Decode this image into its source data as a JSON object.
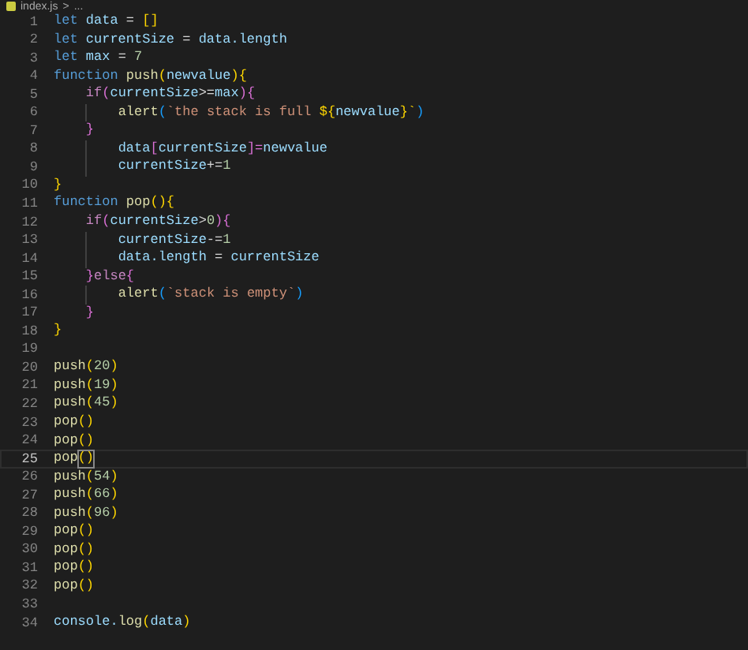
{
  "breadcrumb": {
    "file": "index.js",
    "separator": ">",
    "rest": "..."
  },
  "lines": [
    {
      "number": "1",
      "current": false,
      "tokens": [
        {
          "t": "let ",
          "color": "#569cd6"
        },
        {
          "t": "data",
          "color": "#9cdcfe"
        },
        {
          "t": " = ",
          "color": "#d4d4d4"
        },
        {
          "t": "[]",
          "color": "#ffd700"
        }
      ]
    },
    {
      "number": "2",
      "current": false,
      "tokens": [
        {
          "t": "let ",
          "color": "#569cd6"
        },
        {
          "t": "currentSize",
          "color": "#9cdcfe"
        },
        {
          "t": " = ",
          "color": "#d4d4d4"
        },
        {
          "t": "data.length",
          "color": "#9cdcfe"
        }
      ]
    },
    {
      "number": "3",
      "current": false,
      "tokens": [
        {
          "t": "let ",
          "color": "#569cd6"
        },
        {
          "t": "max",
          "color": "#9cdcfe"
        },
        {
          "t": " = ",
          "color": "#d4d4d4"
        },
        {
          "t": "7",
          "color": "#b5cea8"
        }
      ]
    },
    {
      "number": "4",
      "current": false,
      "tokens": [
        {
          "t": "function ",
          "color": "#569cd6"
        },
        {
          "t": "push",
          "color": "#dcdcaa"
        },
        {
          "t": "(",
          "color": "#ffd700"
        },
        {
          "t": "newvalue",
          "color": "#9cdcfe"
        },
        {
          "t": "){",
          "color": "#ffd700"
        }
      ]
    },
    {
      "number": "5",
      "current": false,
      "tokens": [
        {
          "t": "    if",
          "color": "#c586c0"
        },
        {
          "t": "(",
          "color": "#da70d6"
        },
        {
          "t": "currentSize",
          "color": "#9cdcfe"
        },
        {
          "t": ">=",
          "color": "#d4d4d4"
        },
        {
          "t": "max",
          "color": "#9cdcfe"
        },
        {
          "t": "){",
          "color": "#da70d6"
        }
      ]
    },
    {
      "number": "6",
      "current": false,
      "tokens": [
        {
          "t": "        alert",
          "color": "#dcdcaa"
        },
        {
          "t": "(",
          "color": "#179fff"
        },
        {
          "t": "`the stack is full ",
          "color": "#ce9178"
        },
        {
          "t": "${",
          "color": "#ffd700"
        },
        {
          "t": "newvalue",
          "color": "#9cdcfe"
        },
        {
          "t": "}`",
          "color": "#ffd700"
        },
        {
          "t": ")",
          "color": "#179fff"
        }
      ]
    },
    {
      "number": "7",
      "current": false,
      "tokens": [
        {
          "t": "    }",
          "color": "#da70d6"
        }
      ]
    },
    {
      "number": "8",
      "current": false,
      "tokens": [
        {
          "t": "        data",
          "color": "#9cdcfe"
        },
        {
          "t": "[",
          "color": "#da70d6"
        },
        {
          "t": "currentSize",
          "color": "#9cdcfe"
        },
        {
          "t": "]=",
          "color": "#da70d6"
        },
        {
          "t": "newvalue",
          "color": "#9cdcfe"
        }
      ]
    },
    {
      "number": "9",
      "current": false,
      "tokens": [
        {
          "t": "        currentSize",
          "color": "#9cdcfe"
        },
        {
          "t": "+=",
          "color": "#d4d4d4"
        },
        {
          "t": "1",
          "color": "#b5cea8"
        }
      ]
    },
    {
      "number": "10",
      "current": false,
      "tokens": [
        {
          "t": "}",
          "color": "#ffd700"
        }
      ]
    },
    {
      "number": "11",
      "current": false,
      "tokens": [
        {
          "t": "function ",
          "color": "#569cd6"
        },
        {
          "t": "pop",
          "color": "#dcdcaa"
        },
        {
          "t": "(){",
          "color": "#ffd700"
        }
      ]
    },
    {
      "number": "12",
      "current": false,
      "tokens": [
        {
          "t": "    if",
          "color": "#c586c0"
        },
        {
          "t": "(",
          "color": "#da70d6"
        },
        {
          "t": "currentSize",
          "color": "#9cdcfe"
        },
        {
          "t": ">",
          "color": "#d4d4d4"
        },
        {
          "t": "0",
          "color": "#b5cea8"
        },
        {
          "t": "){",
          "color": "#da70d6"
        }
      ]
    },
    {
      "number": "13",
      "current": false,
      "tokens": [
        {
          "t": "        currentSize",
          "color": "#9cdcfe"
        },
        {
          "t": "-=",
          "color": "#d4d4d4"
        },
        {
          "t": "1",
          "color": "#b5cea8"
        }
      ]
    },
    {
      "number": "14",
      "current": false,
      "tokens": [
        {
          "t": "        data.length",
          "color": "#9cdcfe"
        },
        {
          "t": " = ",
          "color": "#d4d4d4"
        },
        {
          "t": "currentSize",
          "color": "#9cdcfe"
        }
      ]
    },
    {
      "number": "15",
      "current": false,
      "tokens": [
        {
          "t": "    }",
          "color": "#da70d6"
        },
        {
          "t": "else",
          "color": "#c586c0"
        },
        {
          "t": "{",
          "color": "#da70d6"
        }
      ]
    },
    {
      "number": "16",
      "current": false,
      "tokens": [
        {
          "t": "        alert",
          "color": "#dcdcaa"
        },
        {
          "t": "(",
          "color": "#179fff"
        },
        {
          "t": "`stack is empty`",
          "color": "#ce9178"
        },
        {
          "t": ")",
          "color": "#179fff"
        }
      ]
    },
    {
      "number": "17",
      "current": false,
      "tokens": [
        {
          "t": "    }",
          "color": "#da70d6"
        }
      ]
    },
    {
      "number": "18",
      "current": false,
      "tokens": [
        {
          "t": "}",
          "color": "#ffd700"
        }
      ]
    },
    {
      "number": "19",
      "current": false
    },
    {
      "number": "20",
      "current": false,
      "tokens": [
        {
          "t": "push",
          "color": "#dcdcaa"
        },
        {
          "t": "(",
          "color": "#ffd700"
        },
        {
          "t": "20",
          "color": "#b5cea8"
        },
        {
          "t": ")",
          "color": "#ffd700"
        }
      ]
    },
    {
      "number": "21",
      "current": false,
      "tokens": [
        {
          "t": "push",
          "color": "#dcdcaa"
        },
        {
          "t": "(",
          "color": "#ffd700"
        },
        {
          "t": "19",
          "color": "#b5cea8"
        },
        {
          "t": ")",
          "color": "#ffd700"
        }
      ]
    },
    {
      "number": "22",
      "current": false,
      "tokens": [
        {
          "t": "push",
          "color": "#dcdcaa"
        },
        {
          "t": "(",
          "color": "#ffd700"
        },
        {
          "t": "45",
          "color": "#b5cea8"
        },
        {
          "t": ")",
          "color": "#ffd700"
        }
      ]
    },
    {
      "number": "23",
      "current": false,
      "tokens": [
        {
          "t": "pop",
          "color": "#dcdcaa"
        },
        {
          "t": "()",
          "color": "#ffd700"
        }
      ]
    },
    {
      "number": "24",
      "current": false,
      "tokens": [
        {
          "t": "pop",
          "color": "#dcdcaa"
        },
        {
          "t": "()",
          "color": "#ffd700"
        }
      ]
    },
    {
      "number": "25",
      "current": true,
      "tokens": [
        {
          "t": "pop",
          "color": "#dcdcaa"
        },
        {
          "t": "()",
          "color": "#ffd700",
          "matched": true
        }
      ]
    },
    {
      "number": "26",
      "current": false,
      "tokens": [
        {
          "t": "push",
          "color": "#dcdcaa"
        },
        {
          "t": "(",
          "color": "#ffd700"
        },
        {
          "t": "54",
          "color": "#b5cea8"
        },
        {
          "t": ")",
          "color": "#ffd700"
        }
      ]
    },
    {
      "number": "27",
      "current": false,
      "tokens": [
        {
          "t": "push",
          "color": "#dcdcaa"
        },
        {
          "t": "(",
          "color": "#ffd700"
        },
        {
          "t": "66",
          "color": "#b5cea8"
        },
        {
          "t": ")",
          "color": "#ffd700"
        }
      ]
    },
    {
      "number": "28",
      "current": false,
      "tokens": [
        {
          "t": "push",
          "color": "#dcdcaa"
        },
        {
          "t": "(",
          "color": "#ffd700"
        },
        {
          "t": "96",
          "color": "#b5cea8"
        },
        {
          "t": ")",
          "color": "#ffd700"
        }
      ]
    },
    {
      "number": "29",
      "current": false,
      "tokens": [
        {
          "t": "pop",
          "color": "#dcdcaa"
        },
        {
          "t": "()",
          "color": "#ffd700"
        }
      ]
    },
    {
      "number": "30",
      "current": false,
      "tokens": [
        {
          "t": "pop",
          "color": "#dcdcaa"
        },
        {
          "t": "()",
          "color": "#ffd700"
        }
      ]
    },
    {
      "number": "31",
      "current": false,
      "tokens": [
        {
          "t": "pop",
          "color": "#dcdcaa"
        },
        {
          "t": "()",
          "color": "#ffd700"
        }
      ]
    },
    {
      "number": "32",
      "current": false,
      "tokens": [
        {
          "t": "pop",
          "color": "#dcdcaa"
        },
        {
          "t": "()",
          "color": "#ffd700"
        }
      ]
    },
    {
      "number": "33",
      "current": false
    },
    {
      "number": "34",
      "current": false,
      "tokens": [
        {
          "t": "console.",
          "color": "#9cdcfe"
        },
        {
          "t": "log",
          "color": "#dcdcaa"
        },
        {
          "t": "(",
          "color": "#ffd700"
        },
        {
          "t": "data",
          "color": "#9cdcfe"
        },
        {
          "t": ")",
          "color": "#ffd700"
        }
      ]
    }
  ]
}
